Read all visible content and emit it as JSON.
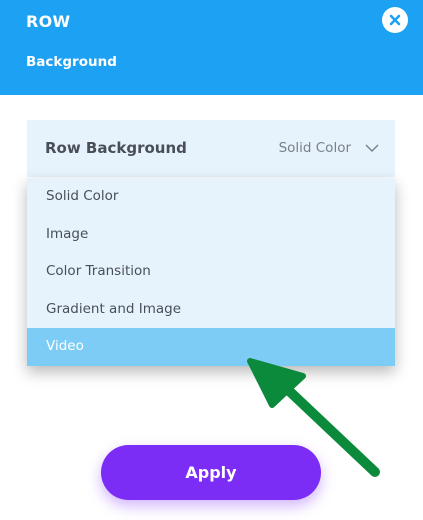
{
  "header": {
    "title": "ROW",
    "subtitle": "Background"
  },
  "select": {
    "label": "Row Background",
    "value": "Solid Color"
  },
  "dropdown": {
    "items": [
      "Solid Color",
      "Image",
      "Color Transition",
      "Gradient and Image",
      "Video"
    ],
    "selected": "Video"
  },
  "footer": {
    "apply_label": "Apply"
  },
  "colors": {
    "header_bg": "#1da1f2",
    "select_bg": "#e6f3fc",
    "selected_item_bg": "#7cccf6",
    "apply_bg": "#7b2cf5",
    "arrow": "#0b8a3c"
  },
  "icons": {
    "close": "close-icon",
    "chevron": "chevron-down-icon",
    "annotation": "arrow-annotation"
  }
}
